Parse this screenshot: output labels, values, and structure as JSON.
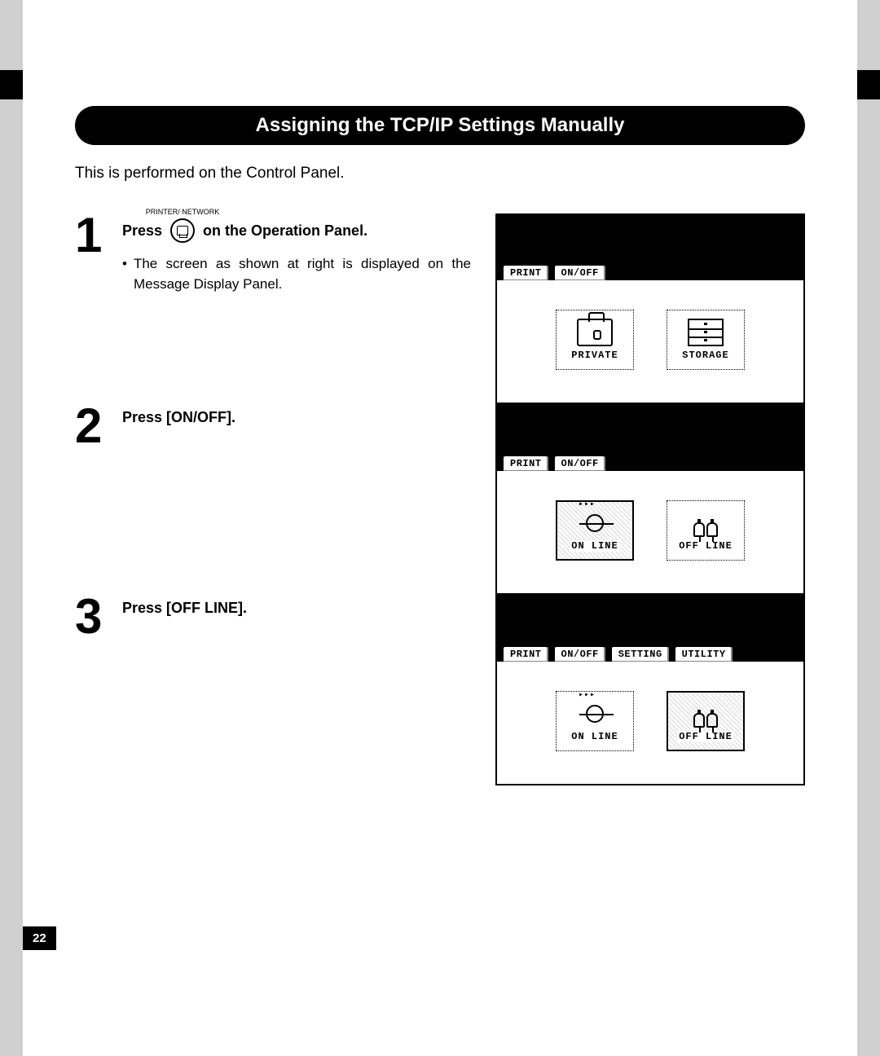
{
  "heading": "Assigning the TCP/IP Settings Manually",
  "intro": "This is performed on the Control Panel.",
  "button_caption": "PRINTER/\nNETWORK",
  "steps": [
    {
      "num": "1",
      "title_before": "Press",
      "title_after": "on the Operation Panel.",
      "bullet": "The screen as shown at right is displayed on the Message Display Panel.",
      "screen": {
        "tabs": [
          "PRINT",
          "ON/OFF"
        ],
        "selected_tab": 0,
        "items": [
          {
            "label": "PRIVATE",
            "icon": "private",
            "selected": false
          },
          {
            "label": "STORAGE",
            "icon": "storage",
            "selected": false
          }
        ]
      }
    },
    {
      "num": "2",
      "title": "Press [ON/OFF].",
      "screen": {
        "tabs": [
          "PRINT",
          "ON/OFF"
        ],
        "selected_tab": 1,
        "items": [
          {
            "label": "ON LINE",
            "icon": "online",
            "selected": true
          },
          {
            "label": "OFF LINE",
            "icon": "offline",
            "selected": false
          }
        ]
      }
    },
    {
      "num": "3",
      "title": "Press [OFF LINE].",
      "screen": {
        "tabs": [
          "PRINT",
          "ON/OFF",
          "SETTING",
          "UTILITY"
        ],
        "selected_tab": 1,
        "items": [
          {
            "label": "ON LINE",
            "icon": "online",
            "selected": false
          },
          {
            "label": "OFF LINE",
            "icon": "offline",
            "selected": true
          }
        ]
      }
    }
  ],
  "page_number": "22"
}
